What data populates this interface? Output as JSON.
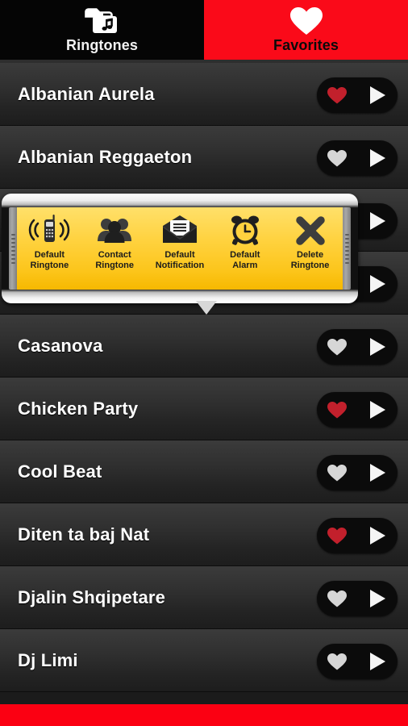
{
  "header": {
    "tabs": [
      {
        "id": "ringtones",
        "label": "Ringtones",
        "icon": "music-folder-icon",
        "active": false,
        "bg": "#050505",
        "text": "#f2f2f2"
      },
      {
        "id": "favorites",
        "label": "Favorites",
        "icon": "heart-icon",
        "active": true,
        "bg": "#fa0a19",
        "text": "#0a0a0a"
      }
    ]
  },
  "colors": {
    "accent_red": "#fa0a19",
    "favorite_on": "#c2202c",
    "favorite_off": "#d6d6d6",
    "panel_yellow": "#ffd23f",
    "row_text": "#ffffff"
  },
  "list": {
    "rows": [
      {
        "title": "Albanian Aurela",
        "favorite": true
      },
      {
        "title": "Albanian Reggaeton",
        "favorite": false
      },
      {
        "title": "",
        "favorite": false,
        "hidden_behind_popup": true
      },
      {
        "title": "",
        "favorite": false,
        "hidden_behind_popup": true
      },
      {
        "title": "Casanova",
        "favorite": false
      },
      {
        "title": "Chicken Party",
        "favorite": true
      },
      {
        "title": "Cool Beat",
        "favorite": false
      },
      {
        "title": "Diten ta baj Nat",
        "favorite": true
      },
      {
        "title": "Djalin Shqipetare",
        "favorite": false
      },
      {
        "title": "Dj Limi",
        "favorite": false
      }
    ]
  },
  "popup": {
    "visible": true,
    "options": [
      {
        "id": "default-ringtone",
        "label": "Default\nRingtone",
        "icon": "ringing-phone-icon"
      },
      {
        "id": "contact-ringtone",
        "label": "Contact\nRingtone",
        "icon": "contacts-group-icon"
      },
      {
        "id": "default-notification",
        "label": "Default\nNotification",
        "icon": "envelope-icon"
      },
      {
        "id": "default-alarm",
        "label": "Default\nAlarm",
        "icon": "alarm-clock-icon"
      },
      {
        "id": "delete-ringtone",
        "label": "Delete\nRingtone",
        "icon": "x-cross-icon"
      }
    ]
  }
}
